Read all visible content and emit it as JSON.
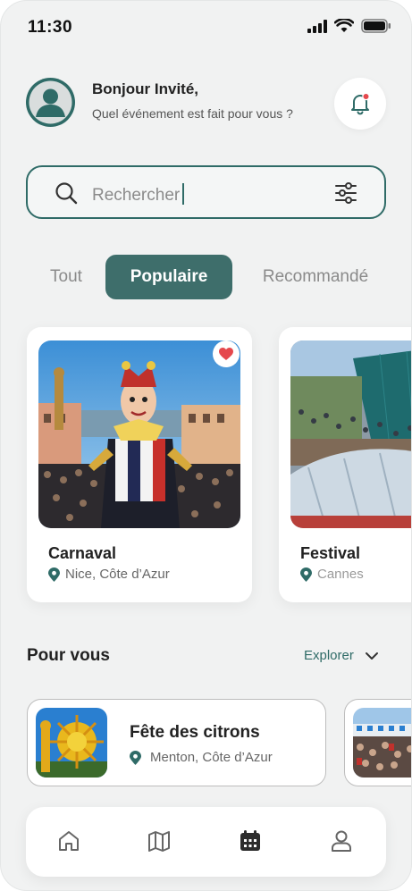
{
  "status": {
    "time": "11:30"
  },
  "header": {
    "greeting": "Bonjour Invité,",
    "subtitle": "Quel événement est fait pour vous ?"
  },
  "search": {
    "placeholder": "Rechercher"
  },
  "tabs": [
    {
      "label": "Tout",
      "active": false
    },
    {
      "label": "Populaire",
      "active": true
    },
    {
      "label": "Recommandé",
      "active": false
    }
  ],
  "popular": [
    {
      "title": "Carnaval",
      "location": "Nice, Côte d’Azur",
      "favorite": true
    },
    {
      "title": "Festival",
      "location": "Cannes",
      "favorite": false
    }
  ],
  "for_you": {
    "title": "Pour vous",
    "explore_label": "Explorer",
    "items": [
      {
        "title": "Fête des citrons",
        "location": "Menton, Côte d’Azur"
      },
      {
        "title": "",
        "location": ""
      }
    ]
  },
  "nav": [
    {
      "icon": "home-icon",
      "active": false
    },
    {
      "icon": "map-icon",
      "active": false
    },
    {
      "icon": "calendar-icon",
      "active": true
    },
    {
      "icon": "profile-icon",
      "active": false
    }
  ],
  "colors": {
    "accent": "#2f6b67",
    "tab_active": "#3e6e6b",
    "background": "#f1f2f2",
    "notification_dot": "#e5484d",
    "heart": "#e5484d"
  }
}
